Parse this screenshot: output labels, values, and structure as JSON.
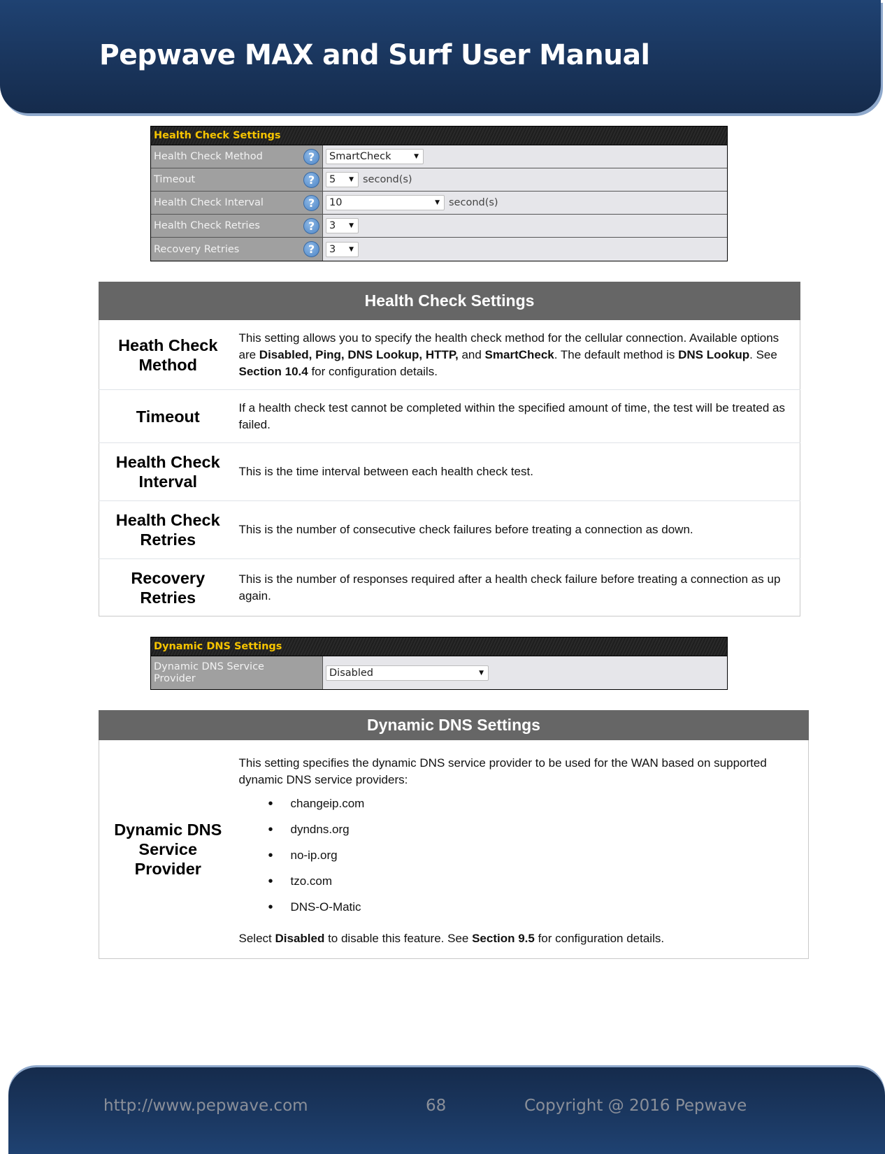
{
  "header": {
    "title": "Pepwave MAX and Surf User Manual"
  },
  "health_ui": {
    "title": "Health Check Settings",
    "rows": [
      {
        "label": "Health Check Method",
        "value": "SmartCheck",
        "unit": ""
      },
      {
        "label": "Timeout",
        "value": "5",
        "unit": "second(s)"
      },
      {
        "label": "Health Check Interval",
        "value": "10",
        "unit": "second(s)"
      },
      {
        "label": "Health Check Retries",
        "value": "3",
        "unit": ""
      },
      {
        "label": "Recovery Retries",
        "value": "3",
        "unit": ""
      }
    ],
    "help_glyph": "?",
    "dropdown_glyph": "▼"
  },
  "health_doc": {
    "title": "Health Check Settings",
    "rows": [
      {
        "term": "Heath Check Method",
        "desc_parts": [
          {
            "t": "This setting allows you to specify the health check method for the cellular connection. Available options are ",
            "b": false
          },
          {
            "t": "Disabled, Ping, DNS Lookup, HTTP,",
            "b": true
          },
          {
            "t": " and ",
            "b": false
          },
          {
            "t": "SmartCheck",
            "b": true
          },
          {
            "t": ". The default method is ",
            "b": false
          },
          {
            "t": "DNS Lookup",
            "b": true
          },
          {
            "t": ". See ",
            "b": false
          },
          {
            "t": "Section 10.4",
            "b": true
          },
          {
            "t": " for configuration details.",
            "b": false
          }
        ]
      },
      {
        "term": "Timeout",
        "desc": "If a health check test cannot be completed within the specified amount of time, the test will be treated as failed."
      },
      {
        "term": "Health Check Interval",
        "desc": "This is the time interval between each health check test."
      },
      {
        "term": "Health Check Retries",
        "desc": "This is the number of consecutive check failures before treating a connection as down."
      },
      {
        "term": "Recovery Retries",
        "desc": "This is the number of responses required after a health check failure before treating a connection as up again."
      }
    ]
  },
  "ddns_ui": {
    "title": "Dynamic DNS Settings",
    "label": "Dynamic DNS Service Provider",
    "value": "Disabled",
    "dropdown_glyph": "▼"
  },
  "ddns_doc": {
    "title": "Dynamic DNS Settings",
    "term": "Dynamic DNS Service Provider",
    "intro": "This setting specifies the dynamic DNS service provider to be used for the WAN based on supported dynamic DNS service providers:",
    "providers": [
      "changeip.com",
      "dyndns.org",
      "no-ip.org",
      "tzo.com",
      "DNS-O-Matic"
    ],
    "outro_1": "Select ",
    "outro_bold_1": "Disabled",
    "outro_2": " to disable this feature. See ",
    "outro_bold_2": "Section 9.5",
    "outro_3": " for configuration details."
  },
  "footer": {
    "url": "http://www.pepwave.com",
    "page": "68",
    "copyright": "Copyright @ 2016 Pepwave"
  }
}
